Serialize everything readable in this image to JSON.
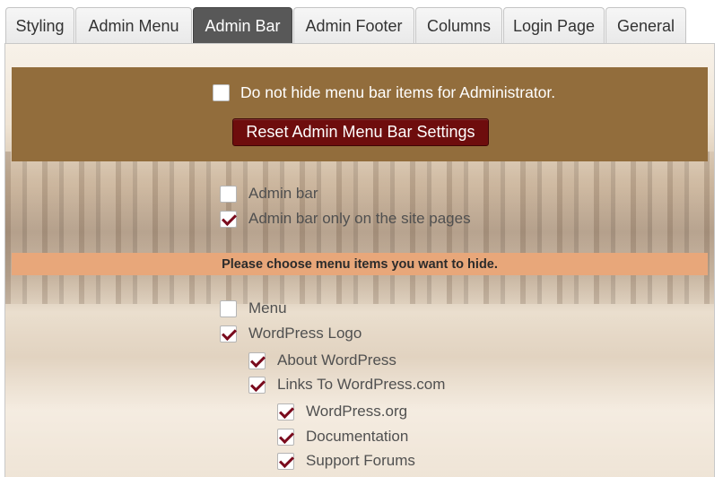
{
  "tabs": [
    {
      "label": "Styling",
      "active": false
    },
    {
      "label": "Admin Menu",
      "active": false
    },
    {
      "label": "Admin Bar",
      "active": true
    },
    {
      "label": "Admin Footer",
      "active": false
    },
    {
      "label": "Columns",
      "active": false
    },
    {
      "label": "Login Page",
      "active": false
    },
    {
      "label": "General",
      "active": false
    }
  ],
  "top_section": {
    "checkbox_label": "Do not hide menu bar items for Administrator.",
    "checkbox_checked": false,
    "reset_button": "Reset Admin Menu Bar Settings"
  },
  "admin_bar_options": [
    {
      "label": "Admin bar",
      "checked": false
    },
    {
      "label": "Admin bar only on the site pages",
      "checked": true
    }
  ],
  "instruction": "Please choose menu items you want to hide.",
  "menu_items": [
    {
      "label": "Menu",
      "checked": false,
      "level": 0
    },
    {
      "label": "WordPress Logo",
      "checked": true,
      "level": 0
    },
    {
      "label": "About WordPress",
      "checked": true,
      "level": 1
    },
    {
      "label": "Links To WordPress.com",
      "checked": true,
      "level": 1
    },
    {
      "label": "WordPress.org",
      "checked": true,
      "level": 2
    },
    {
      "label": "Documentation",
      "checked": true,
      "level": 2
    },
    {
      "label": "Support Forums",
      "checked": true,
      "level": 2
    }
  ],
  "colors": {
    "active_tab": "#585858",
    "top_box": "#926d3c",
    "reset_button": "#6e0d0d",
    "instruction_bar": "#e8a77a",
    "checkmark": "#7a0b1d"
  }
}
